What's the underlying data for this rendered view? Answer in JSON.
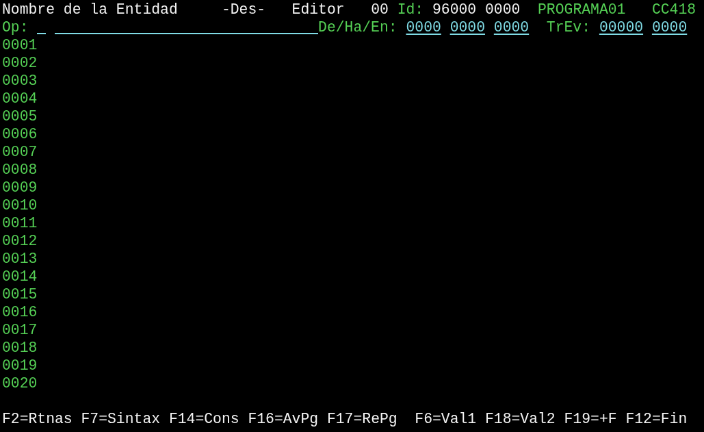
{
  "header": [
    {
      "kind": "text",
      "text": "Nombre de la Entidad"
    },
    {
      "kind": "text",
      "text": "-Des-"
    },
    {
      "kind": "text",
      "text": "Editor"
    },
    {
      "kind": "text",
      "text": "00"
    },
    {
      "kind": "label",
      "text": "Id:"
    },
    {
      "kind": "text",
      "text": "96000"
    },
    {
      "kind": "text",
      "text": "0000"
    },
    {
      "kind": "label",
      "text": "PROGRAMA01"
    },
    {
      "kind": "label",
      "text": "CC418"
    }
  ],
  "command_line": [
    {
      "kind": "label",
      "text": "Op:"
    },
    {
      "kind": "input"
    },
    {
      "kind": "input"
    },
    {
      "kind": "label",
      "text": "De/Ha/En:"
    },
    {
      "kind": "field",
      "text": "0000"
    },
    {
      "kind": "field",
      "text": "0000"
    },
    {
      "kind": "field",
      "text": "0000"
    },
    {
      "kind": "label",
      "text": "TrEv:"
    },
    {
      "kind": "field",
      "text": "00000"
    },
    {
      "kind": "field",
      "text": "0000"
    }
  ],
  "lines": [
    "0001",
    "0002",
    "0003",
    "0004",
    "0005",
    "0006",
    "0007",
    "0008",
    "0009",
    "0010",
    "0011",
    "0012",
    "0013",
    "0014",
    "0015",
    "0016",
    "0017",
    "0018",
    "0019",
    "0020"
  ],
  "function_keys": "F2=Rtnas F7=Sintax F14=Cons F16=AvPg F17=RePg  F6=Val1 F18=Val2 F19=+F F12=Fin"
}
